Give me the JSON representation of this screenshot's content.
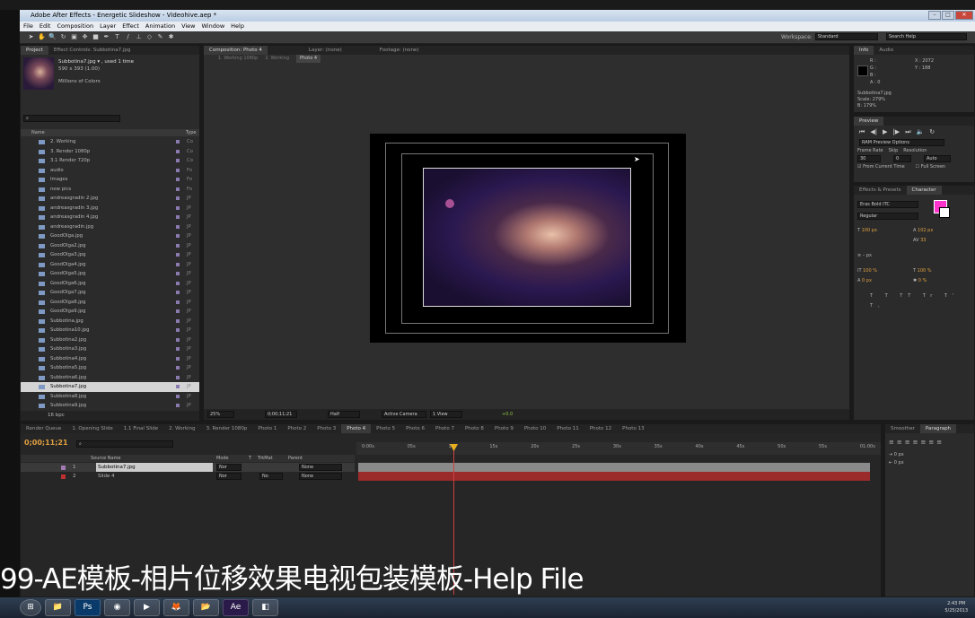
{
  "app": {
    "title": "Adobe After Effects - Energetic Slideshow - Videohive.aep *"
  },
  "menu": [
    "File",
    "Edit",
    "Composition",
    "Layer",
    "Effect",
    "Animation",
    "View",
    "Window",
    "Help"
  ],
  "workspace": {
    "label": "Workspace:",
    "value": "Standard",
    "search_placeholder": "Search Help"
  },
  "project": {
    "tabs": [
      "Project",
      "Effect Controls: Subbotina7.jpg"
    ],
    "file": "Subbotina7.jpg ▾ , used 1 time",
    "dims": "590 x 393 (1.00)",
    "colors": "Millions of Colors",
    "col_name": "Name",
    "col_type": "Type",
    "items": [
      {
        "label": "2. Working",
        "type": "Co"
      },
      {
        "label": "3. Render 1080p",
        "type": "Co"
      },
      {
        "label": "3.1 Render 720p",
        "type": "Co"
      },
      {
        "label": "audio",
        "type": "Fo"
      },
      {
        "label": "Images",
        "type": "Fo"
      },
      {
        "label": "new pics",
        "type": "Fo"
      },
      {
        "label": "andreasgradin 2.jpg",
        "type": "JP"
      },
      {
        "label": "andreasgradin 3.jpg",
        "type": "JP"
      },
      {
        "label": "andreasgradin 4.jpg",
        "type": "JP"
      },
      {
        "label": "andreasgradin.jpg",
        "type": "JP"
      },
      {
        "label": "GoodOlga.jpg",
        "type": "JP"
      },
      {
        "label": "GoodOlga2.jpg",
        "type": "JP"
      },
      {
        "label": "GoodOlga3.jpg",
        "type": "JP"
      },
      {
        "label": "GoodOlga4.jpg",
        "type": "JP"
      },
      {
        "label": "GoodOlga5.jpg",
        "type": "JP"
      },
      {
        "label": "GoodOlga6.jpg",
        "type": "JP"
      },
      {
        "label": "GoodOlga7.jpg",
        "type": "JP"
      },
      {
        "label": "GoodOlga8.jpg",
        "type": "JP"
      },
      {
        "label": "GoodOlga9.jpg",
        "type": "JP"
      },
      {
        "label": "Subbotina.jpg",
        "type": "JP"
      },
      {
        "label": "Subbotina10.jpg",
        "type": "JP"
      },
      {
        "label": "Subbotina2.jpg",
        "type": "JP"
      },
      {
        "label": "Subbotina3.jpg",
        "type": "JP"
      },
      {
        "label": "Subbotina4.jpg",
        "type": "JP"
      },
      {
        "label": "Subbotina5.jpg",
        "type": "JP"
      },
      {
        "label": "Subbotina6.jpg",
        "type": "JP"
      },
      {
        "label": "Subbotina7.jpg",
        "type": "JP"
      },
      {
        "label": "Subbotina8.jpg",
        "type": "JP"
      },
      {
        "label": "Subbotina9.jpg",
        "type": "JP"
      }
    ],
    "bpc": "16 bpc"
  },
  "comp": {
    "tabs": [
      "Composition: Photo 4",
      "Layer: (none)",
      "Footage: (none)"
    ],
    "crumbs": [
      "1. Working 1080p",
      "2. Working",
      "Photo 4"
    ],
    "zoom": "25%",
    "timecode": "0;00;11;21",
    "res": "Half",
    "camera": "Active Camera",
    "view": "1 View",
    "exposure": "+0.0"
  },
  "info": {
    "tabs": [
      "Info",
      "Audio"
    ],
    "r": "R :",
    "g": "G :",
    "b": "B :",
    "a": "A : 0",
    "x": "X : 2072",
    "y": "Y : 188",
    "file": "Subbotina7.jpg",
    "scale": "Scale: 279%",
    "scale2": "B: 179%"
  },
  "preview": {
    "tab": "Preview",
    "ram": "RAM Preview Options",
    "framerate": "Frame Rate",
    "skip": "Skip",
    "resolution": "Resolution",
    "fr_val": "30",
    "skip_val": "0",
    "res_val": "Auto",
    "from_current": "From Current Time",
    "full_screen": "Full Screen"
  },
  "character": {
    "tabs": [
      "Effects & Presets",
      "Character"
    ],
    "font": "Eras Bold ITC",
    "style": "Regular",
    "size": "100 px",
    "leading": "102 px",
    "tracking": "33",
    "px": "px",
    "vscale": "100 %",
    "hscale": "100 %",
    "baseline": "0 px",
    "tsume": "0 %",
    "swatch": "#ff33cc"
  },
  "paragraph": {
    "tabs": [
      "Smoother",
      "Paragraph"
    ],
    "indent": "0 px"
  },
  "timeline": {
    "tabs": [
      "Render Queue",
      "1. Opening Slide",
      "1.1 Final Slide",
      "2. Working",
      "3. Render 1080p",
      "Photo 1",
      "Photo 2",
      "Photo 3",
      "Photo 4",
      "Photo 5",
      "Photo 6",
      "Photo 7",
      "Photo 8",
      "Photo 9",
      "Photo 10",
      "Photo 11",
      "Photo 12",
      "Photo 13"
    ],
    "timecode": "0;00;11;21",
    "cols": [
      "Source Name",
      "Mode",
      "T",
      "TrkMat",
      "Parent"
    ],
    "layers": [
      {
        "num": "1",
        "name": "Subbotina7.jpg",
        "mode": "Nor",
        "trk": "",
        "parent": "None"
      },
      {
        "num": "2",
        "name": "Slide 4",
        "mode": "Nor",
        "trk": "No",
        "parent": "None"
      }
    ],
    "ticks": [
      "0:00s",
      "05s",
      "10s",
      "15s",
      "20s",
      "25s",
      "30s",
      "35s",
      "40s",
      "45s",
      "50s",
      "55s",
      "01:00s"
    ]
  },
  "subtitle": "99-AE模板-相片位移效果电视包装模板-Help File",
  "clock": {
    "time": "2:43 PM",
    "date": "5/25/2013"
  },
  "taskbar": {
    "apps": [
      "⊞",
      "📁",
      "Ps",
      "◉",
      "▶",
      "🦊",
      "📂",
      "Ae",
      "◧"
    ]
  }
}
